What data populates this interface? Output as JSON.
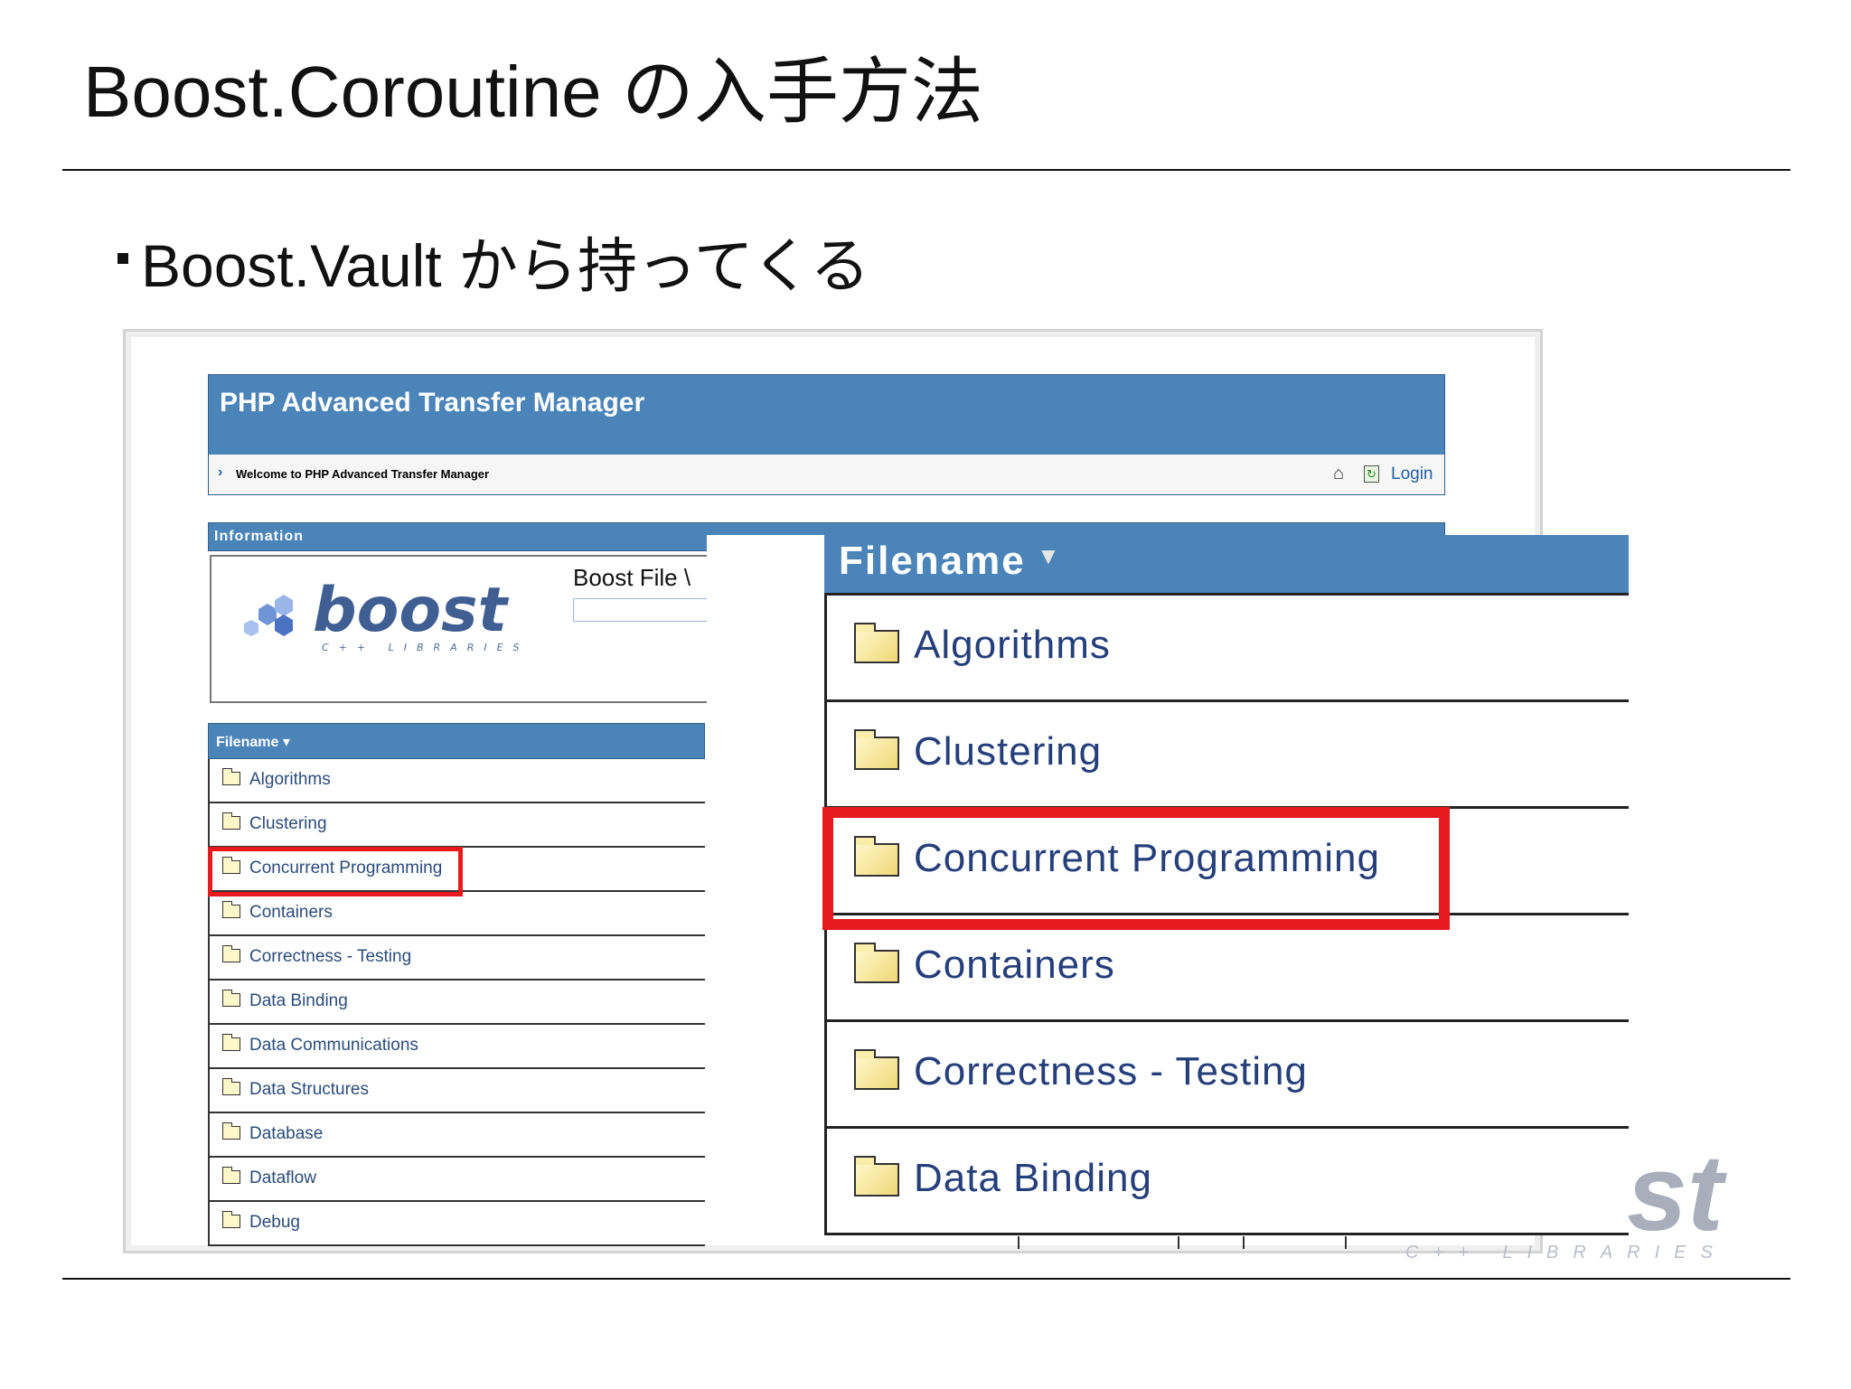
{
  "slide": {
    "title": "Boost.Coroutine の入手方法",
    "bullet": "Boost.Vault から持ってくる"
  },
  "app": {
    "title": "PHP Advanced Transfer Manager",
    "welcome": "Welcome to PHP Advanced Transfer Manager",
    "login": "Login",
    "icons": [
      "home-icon",
      "refresh-icon"
    ]
  },
  "info": {
    "label": "Information",
    "logo_text": "boost",
    "logo_sub": "C++ LIBRARIES",
    "file_label": "Boost File \\"
  },
  "file_list": {
    "header": "Filename",
    "items": [
      {
        "label": "Algorithms"
      },
      {
        "label": "Clustering"
      },
      {
        "label": "Concurrent Programming"
      },
      {
        "label": "Containers"
      },
      {
        "label": "Correctness - Testing"
      },
      {
        "label": "Data Binding"
      },
      {
        "label": "Data Communications"
      },
      {
        "label": "Data Structures"
      },
      {
        "label": "Database"
      },
      {
        "label": "Dataflow"
      },
      {
        "label": "Debug"
      }
    ],
    "highlighted": "Concurrent Programming"
  },
  "zoom": {
    "header": "Filename",
    "items": [
      {
        "label": "Algorithms"
      },
      {
        "label": "Clustering"
      },
      {
        "label": "Concurrent Programming"
      },
      {
        "label": "Containers"
      },
      {
        "label": "Correctness - Testing"
      },
      {
        "label": "Data Binding"
      }
    ]
  },
  "background_logo": {
    "text": "st",
    "sub": "C++ LIBRARIES"
  },
  "colors": {
    "header_blue": "#4a84b8",
    "highlight_red": "#e8191c",
    "link_blue": "#2a4c7a"
  }
}
